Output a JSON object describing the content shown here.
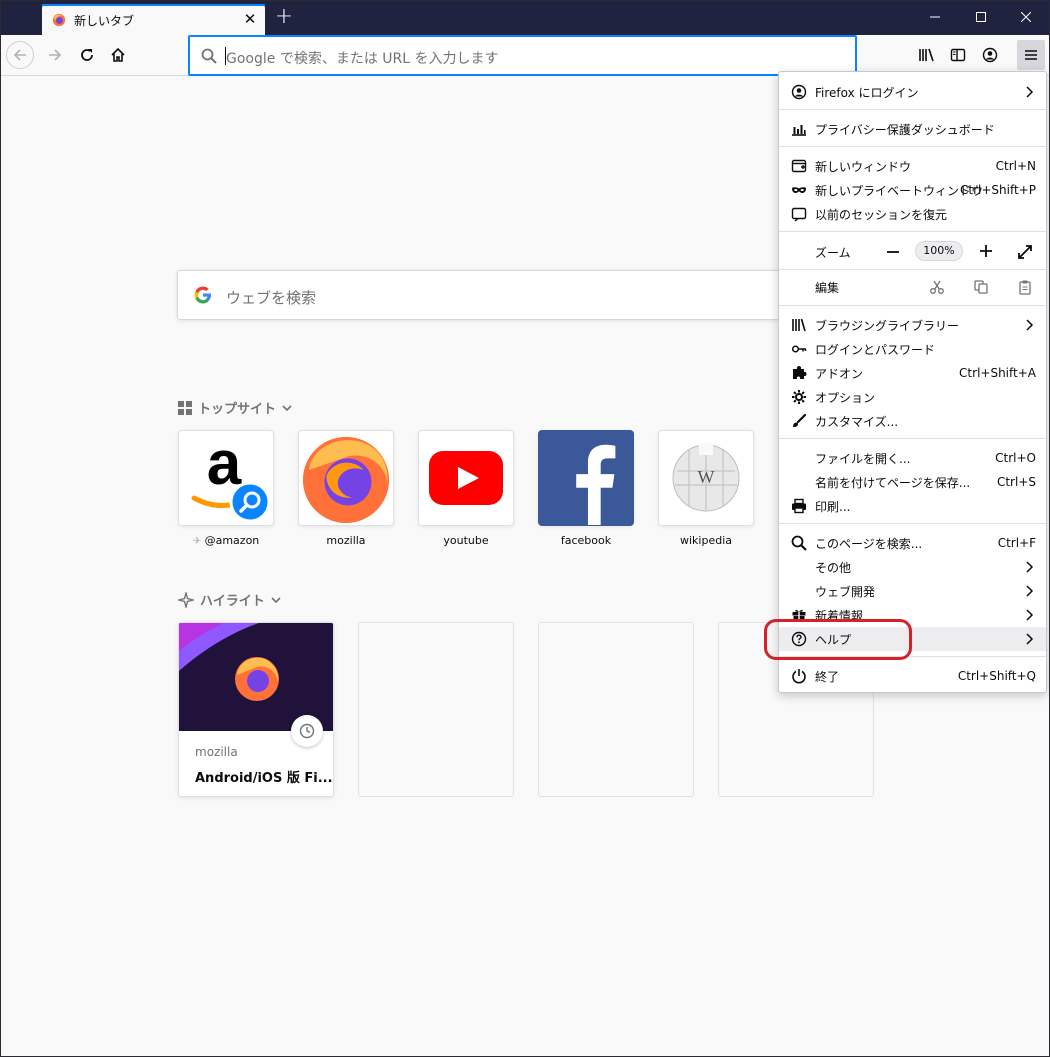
{
  "tab": {
    "title": "新しいタブ"
  },
  "urlbar": {
    "placeholder": "Google で検索、または URL を入力します"
  },
  "newtab": {
    "search_placeholder": "ウェブを検索",
    "topsites_header": "トップサイト",
    "highlights_header": "ハイライト",
    "topsites": [
      {
        "label": "@amazon"
      },
      {
        "label": "mozilla"
      },
      {
        "label": "youtube"
      },
      {
        "label": "facebook"
      },
      {
        "label": "wikipedia"
      }
    ],
    "highlight_card": {
      "source": "mozilla",
      "title": "Android/iOS 版 Fi..."
    }
  },
  "menu": {
    "signin": "Firefox にログイン",
    "privacy_dashboard": "プライバシー保護ダッシュボード",
    "new_window": "新しいウィンドウ",
    "new_window_shortcut": "Ctrl+N",
    "new_private_window": "新しいプライベートウィンドウ",
    "new_private_window_shortcut": "Ctrl+Shift+P",
    "restore_session": "以前のセッションを復元",
    "zoom_label": "ズーム",
    "zoom_value": "100%",
    "edit_label": "編集",
    "library": "ブラウジングライブラリー",
    "logins": "ログインとパスワード",
    "addons": "アドオン",
    "addons_shortcut": "Ctrl+Shift+A",
    "options": "オプション",
    "customize": "カスタマイズ...",
    "open_file": "ファイルを開く...",
    "open_file_shortcut": "Ctrl+O",
    "save_page": "名前を付けてページを保存...",
    "save_page_shortcut": "Ctrl+S",
    "print": "印刷...",
    "find": "このページを検索...",
    "find_shortcut": "Ctrl+F",
    "more": "その他",
    "web_developer": "ウェブ開発",
    "whats_new": "新着情報",
    "help": "ヘルプ",
    "quit": "終了",
    "quit_shortcut": "Ctrl+Shift+Q"
  },
  "colors": {
    "accent": "#0a84ff",
    "titlebar": "#202340",
    "annotation": "#d3222a"
  }
}
